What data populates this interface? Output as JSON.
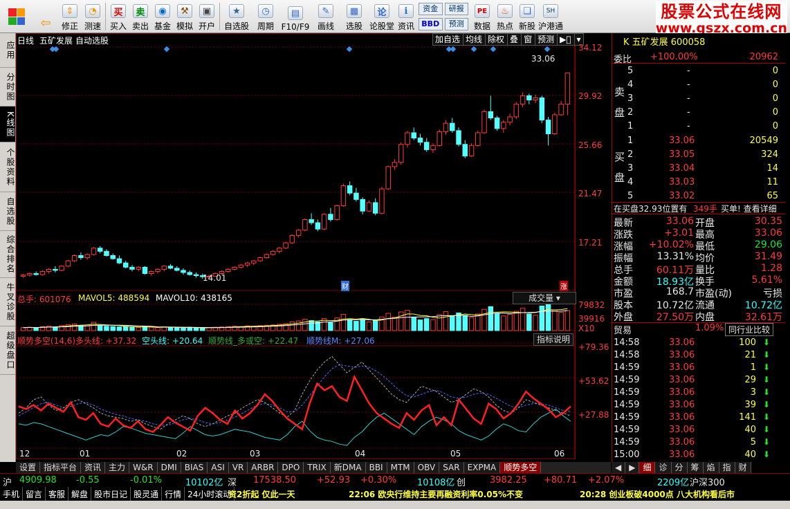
{
  "toolbar": [
    {
      "label": "修正",
      "icon": "up-down-arrows-icon"
    },
    {
      "label": "测速",
      "icon": "speedometer-icon"
    },
    {
      "label": "买入",
      "icon": "buy-icon",
      "glyph": "买"
    },
    {
      "label": "卖出",
      "icon": "sell-icon",
      "glyph": "卖"
    },
    {
      "label": "基金",
      "icon": "fund-icon"
    },
    {
      "label": "模拟",
      "icon": "hammer-icon"
    },
    {
      "label": "开户",
      "icon": "lock-icon"
    },
    {
      "label": "自选股",
      "icon": "star-folder-icon"
    },
    {
      "label": "周期",
      "icon": "clock-icon"
    },
    {
      "label": "F10/F9",
      "icon": "f10-icon"
    },
    {
      "label": "画线",
      "icon": "pen-icon"
    },
    {
      "label": "选股",
      "icon": "screen-icon"
    },
    {
      "label": "论股堂",
      "icon": "chat-icon"
    },
    {
      "label": "资讯",
      "icon": "info-icon"
    },
    {
      "label": "数据",
      "icon": "pe-icon"
    },
    {
      "label": "热点",
      "icon": "fire-icon"
    },
    {
      "label": "新股",
      "icon": "new-stock-icon"
    },
    {
      "label": "沪港通",
      "icon": "hk-icon"
    }
  ],
  "toolbar_mini": {
    "zijin": "资金",
    "yanbao": "研报",
    "bbd": "BBD",
    "yuce": "预测"
  },
  "logo": {
    "line1": "股票公式在线网",
    "line2": "www.gszx.com.cn"
  },
  "left_tabs": [
    "应用",
    "分时图",
    "K线图",
    "个股资料",
    "自选股",
    "综合排名",
    "牛叉诊股",
    "超级盘口"
  ],
  "chart_header": {
    "period": "日线",
    "name": "五矿发展",
    "mode": "自动选股",
    "buttons": [
      "加自选",
      "均线",
      "除权",
      "叠",
      "窗",
      "预测"
    ]
  },
  "price_axis": [
    "34.12",
    "29.92",
    "25.66",
    "21.47",
    "17.21"
  ],
  "price_labels": {
    "high": "33.06",
    "low": "14.01",
    "cai": "财",
    "zhang": "涨"
  },
  "volume_header": {
    "total": "总手: 601076",
    "mavol5": "MAVOL5: 488594",
    "mavol10": "MAVOL10: 438165",
    "selector": "成交量"
  },
  "volume_axis": [
    "79832",
    "39916",
    "X10"
  ],
  "indicator_header": {
    "name": "顺势多空(14,6)",
    "duotou": "多头线: +37.32",
    "kongtou": "空头线: +20.64",
    "shunshi": "顺势线_多或空: +22.47",
    "shunshiM": "顺势线M: +27.06",
    "help": "指标说明"
  },
  "indicator_axis": [
    "+79.36",
    "+53.62",
    "+27.88"
  ],
  "x_axis": [
    "12",
    "01",
    "02",
    "03",
    "04",
    "05",
    "06"
  ],
  "bottom_tabs": [
    "设置",
    "指标平台",
    "资讯",
    "主力",
    "W&R",
    "DMI",
    "BIAS",
    "ASI",
    "VR",
    "ARBR",
    "DPO",
    "TRIX",
    "新DMA",
    "BBI",
    "MTM",
    "OBV",
    "SAR",
    "EXPMA",
    "顺势多空"
  ],
  "bottom_tabs_right": [
    "细",
    "诊",
    "分",
    "筹",
    "焰",
    "指",
    "财"
  ],
  "quote": {
    "title": "K 五矿发展 600058",
    "weibi": "委比",
    "weibi_val": "+100.00%",
    "weibi_num": "20962",
    "sell_label": [
      "卖",
      "盘"
    ],
    "buy_label": [
      "买",
      "盘"
    ],
    "sell": [
      [
        "5",
        "-",
        "0"
      ],
      [
        "4",
        "-",
        "0"
      ],
      [
        "3",
        "-",
        "0"
      ],
      [
        "2",
        "-",
        "0"
      ],
      [
        "1",
        "-",
        "0"
      ]
    ],
    "buy": [
      [
        "1",
        "33.06",
        "20549"
      ],
      [
        "2",
        "33.05",
        "324"
      ],
      [
        "3",
        "33.04",
        "14"
      ],
      [
        "4",
        "33.03",
        "11"
      ],
      [
        "5",
        "33.02",
        "65"
      ]
    ],
    "buy_note": "在买盘32.93位置有",
    "buy_note_amt": "349手",
    "buy_note2": "买单! 查看详细",
    "stats": [
      [
        "最新",
        "33.06",
        "开盘",
        "30.35"
      ],
      [
        "涨跌",
        "+3.01",
        "最高",
        "33.06"
      ],
      [
        "涨幅",
        "+10.02%",
        "最低",
        "29.06"
      ],
      [
        "振幅",
        "13.31%",
        "均价",
        "31.49"
      ],
      [
        "总手",
        "60.11万",
        "量比",
        "1.28"
      ],
      [
        "金额",
        "18.93亿",
        "换手",
        "5.61%"
      ],
      [
        "市盈",
        "168.7",
        "市盈(动)",
        "亏损"
      ],
      [
        "股本",
        "10.72亿",
        "流通",
        "10.72亿"
      ],
      [
        "外盘",
        "27.50万",
        "内盘",
        "32.61万"
      ]
    ],
    "industry": "贸易",
    "industry_pct": "1.09%",
    "industry_btn": "同行业比较",
    "ticks": [
      [
        "14:58",
        "33.06",
        "100"
      ],
      [
        "14:58",
        "33.06",
        "21"
      ],
      [
        "14:59",
        "33.06",
        "1"
      ],
      [
        "14:59",
        "33.06",
        "29"
      ],
      [
        "14:59",
        "33.06",
        "3"
      ],
      [
        "14:59",
        "33.06",
        "39"
      ],
      [
        "14:59",
        "33.06",
        "141"
      ],
      [
        "14:59",
        "33.06",
        "40"
      ],
      [
        "14:59",
        "33.06",
        "5"
      ],
      [
        "15:00",
        "33.06",
        "40"
      ]
    ]
  },
  "status": {
    "sh": "沪",
    "sh_val": "4909.98",
    "sh_chg": "-0.55",
    "sh_pct": "-0.01%",
    "sh_amt": "10102亿",
    "sz": "深",
    "sz_val": "17538.50",
    "sz_chg": "+52.93",
    "sz_pct": "+0.30%",
    "sz_amt": "10108亿",
    "cy": "创",
    "cy_val": "3982.25",
    "cy_chg": "+80.71",
    "cy_pct": "+2.07%",
    "cy_amt": "2209亿",
    "hs": "沪深300"
  },
  "news": {
    "items": [
      "手机",
      "留言",
      "客服",
      "解盘",
      "股市日记",
      "股灵通",
      "行情",
      "24小时滚动"
    ],
    "n1": "资2折起 仅此一天",
    "n2": "22:06 欧央行维持主要再融资利率0.05%不变",
    "n3": "20:28 创业板破4000点 八大机构看后市"
  },
  "colors": {
    "up": "#ff3b3b",
    "down": "#54ffff",
    "grid": "#7a0000"
  },
  "chart_data": {
    "type": "candlestick",
    "ylim": [
      12.5,
      35.5
    ],
    "ohlc": [
      [
        13.85,
        14.05,
        13.7,
        13.95
      ],
      [
        13.95,
        14.2,
        13.8,
        14.1
      ],
      [
        14.1,
        14.3,
        13.9,
        14.0
      ],
      [
        14.0,
        14.4,
        13.9,
        14.3
      ],
      [
        14.3,
        14.6,
        14.1,
        14.5
      ],
      [
        14.5,
        14.8,
        14.2,
        14.4
      ],
      [
        14.4,
        14.9,
        14.3,
        14.8
      ],
      [
        14.8,
        15.4,
        14.7,
        15.3
      ],
      [
        15.3,
        15.9,
        15.2,
        15.8
      ],
      [
        15.8,
        16.1,
        15.4,
        15.6
      ],
      [
        15.6,
        16.0,
        15.4,
        15.9
      ],
      [
        15.9,
        16.6,
        15.8,
        16.5
      ],
      [
        16.5,
        16.7,
        16.0,
        16.2
      ],
      [
        16.2,
        16.4,
        15.7,
        15.8
      ],
      [
        15.8,
        16.0,
        15.4,
        15.5
      ],
      [
        15.5,
        15.8,
        15.0,
        15.1
      ],
      [
        15.1,
        15.3,
        14.6,
        14.7
      ],
      [
        14.7,
        14.9,
        14.3,
        14.5
      ],
      [
        14.5,
        14.8,
        14.3,
        14.7
      ],
      [
        14.7,
        14.8,
        14.0,
        14.1
      ],
      [
        14.1,
        14.4,
        13.9,
        14.3
      ],
      [
        14.3,
        14.6,
        14.1,
        14.5
      ],
      [
        14.5,
        14.9,
        14.3,
        14.8
      ],
      [
        14.8,
        15.0,
        14.5,
        14.6
      ],
      [
        14.6,
        14.8,
        14.3,
        14.4
      ],
      [
        14.4,
        14.6,
        14.0,
        14.2
      ],
      [
        14.2,
        14.4,
        13.9,
        14.0
      ],
      [
        14.0,
        14.2,
        13.7,
        13.9
      ],
      [
        13.9,
        14.1,
        13.6,
        13.8
      ],
      [
        13.8,
        14.0,
        13.6,
        13.85
      ],
      [
        13.85,
        14.2,
        13.8,
        14.1
      ],
      [
        14.1,
        14.4,
        14.0,
        14.3
      ],
      [
        14.3,
        14.6,
        14.2,
        14.5
      ],
      [
        14.5,
        14.8,
        14.4,
        14.7
      ],
      [
        14.7,
        15.0,
        14.6,
        14.9
      ],
      [
        14.9,
        15.2,
        14.7,
        15.1
      ],
      [
        15.1,
        15.4,
        14.9,
        15.3
      ],
      [
        15.3,
        15.7,
        15.2,
        15.6
      ],
      [
        15.6,
        16.0,
        15.5,
        15.9
      ],
      [
        15.9,
        16.3,
        15.8,
        16.2
      ],
      [
        16.2,
        16.6,
        16.0,
        16.5
      ],
      [
        16.5,
        17.1,
        16.4,
        17.0
      ],
      [
        17.0,
        17.8,
        16.9,
        17.7
      ],
      [
        17.7,
        18.3,
        17.5,
        18.2
      ],
      [
        18.2,
        19.3,
        18.1,
        19.2
      ],
      [
        19.2,
        19.8,
        18.7,
        18.9
      ],
      [
        18.9,
        19.2,
        18.1,
        18.3
      ],
      [
        18.3,
        19.8,
        18.2,
        19.7
      ],
      [
        19.7,
        20.3,
        19.0,
        19.2
      ],
      [
        19.2,
        20.6,
        19.1,
        20.5
      ],
      [
        20.5,
        22.6,
        20.4,
        22.4
      ],
      [
        22.4,
        22.8,
        21.5,
        21.7
      ],
      [
        21.7,
        22.2,
        20.9,
        21.1
      ],
      [
        21.1,
        21.3,
        19.7,
        20.0
      ],
      [
        20.0,
        21.0,
        19.9,
        20.8
      ],
      [
        20.8,
        21.2,
        19.6,
        19.8
      ],
      [
        19.8,
        22.3,
        19.7,
        22.1
      ],
      [
        22.1,
        24.3,
        22.0,
        24.2
      ],
      [
        24.2,
        24.9,
        23.9,
        24.6
      ],
      [
        24.6,
        26.5,
        24.4,
        26.3
      ],
      [
        26.3,
        27.6,
        26.0,
        27.4
      ],
      [
        27.4,
        27.9,
        26.7,
        26.9
      ],
      [
        26.9,
        27.3,
        26.2,
        26.5
      ],
      [
        26.5,
        26.9,
        25.6,
        25.8
      ],
      [
        25.8,
        26.4,
        25.5,
        26.2
      ],
      [
        26.2,
        27.7,
        26.1,
        27.5
      ],
      [
        27.5,
        28.6,
        27.2,
        28.3
      ],
      [
        28.3,
        28.8,
        27.4,
        27.6
      ],
      [
        27.6,
        27.9,
        26.1,
        26.3
      ],
      [
        26.3,
        26.7,
        25.0,
        25.2
      ],
      [
        25.2,
        26.4,
        25.1,
        26.2
      ],
      [
        26.2,
        27.6,
        26.1,
        27.4
      ],
      [
        27.4,
        29.6,
        27.3,
        29.4
      ],
      [
        29.4,
        30.9,
        28.6,
        28.8
      ],
      [
        28.8,
        29.0,
        27.6,
        27.8
      ],
      [
        27.8,
        28.6,
        27.4,
        28.4
      ],
      [
        28.4,
        29.2,
        28.1,
        28.9
      ],
      [
        28.9,
        30.3,
        28.7,
        30.1
      ],
      [
        30.1,
        31.2,
        29.8,
        30.9
      ],
      [
        30.9,
        31.1,
        30.1,
        30.5
      ],
      [
        30.5,
        31.0,
        30.2,
        30.7
      ],
      [
        30.7,
        30.9,
        28.3,
        28.6
      ],
      [
        28.6,
        28.9,
        26.2,
        27.3
      ],
      [
        27.3,
        29.3,
        27.2,
        29.1
      ],
      [
        29.1,
        30.4,
        29.0,
        30.1
      ],
      [
        30.1,
        33.06,
        29.06,
        33.06
      ]
    ],
    "volume": [
      0.9,
      1.0,
      0.8,
      1.2,
      1.3,
      1.1,
      1.5,
      1.8,
      2.0,
      1.6,
      1.7,
      2.5,
      1.4,
      1.3,
      1.2,
      1.1,
      1.3,
      1.0,
      0.9,
      1.2,
      1.0,
      0.9,
      1.1,
      1.0,
      0.8,
      0.9,
      1.0,
      0.8,
      0.7,
      0.9,
      1.0,
      1.1,
      1.2,
      1.3,
      1.2,
      1.4,
      1.3,
      1.5,
      1.6,
      1.7,
      1.9,
      2.1,
      2.6,
      2.9,
      3.4,
      3.0,
      2.6,
      3.6,
      2.4,
      3.8,
      4.9,
      3.3,
      2.8,
      3.4,
      2.6,
      3.0,
      4.1,
      5.2,
      4.0,
      5.6,
      6.1,
      3.9,
      3.2,
      3.6,
      3.3,
      4.8,
      5.7,
      4.5,
      5.3,
      4.6,
      3.9,
      5.0,
      6.4,
      7.2,
      5.1,
      4.4,
      4.9,
      5.8,
      6.7,
      5.0,
      4.6,
      7.4,
      7.9,
      6.2,
      5.5,
      6.0
    ]
  },
  "indicator_data": {
    "ylim": [
      12,
      88
    ],
    "duotou": [
      43,
      41,
      44,
      40,
      45,
      42,
      39,
      46,
      35,
      33,
      38,
      30,
      28,
      34,
      29,
      27,
      32,
      26,
      24,
      29,
      35,
      31,
      28,
      25,
      36,
      42,
      38,
      33,
      30,
      40,
      34,
      38,
      44,
      52,
      47,
      40,
      34,
      30,
      26,
      45,
      60,
      55,
      58,
      50,
      47,
      65,
      55,
      45,
      38,
      34,
      30,
      27,
      38,
      33,
      40,
      44,
      29,
      35,
      29,
      48,
      41,
      34,
      30,
      45,
      41,
      34,
      38,
      45,
      54,
      49,
      45,
      41,
      35,
      38,
      43
    ],
    "kongtou": [
      30,
      29,
      31,
      30,
      28,
      26,
      24,
      22,
      20,
      18,
      20,
      22,
      21,
      24,
      28,
      27,
      25,
      23,
      22,
      21,
      20,
      19,
      23,
      28,
      25,
      22,
      21,
      22,
      24,
      26,
      25,
      24,
      22,
      20,
      19,
      18,
      22,
      28,
      32,
      25,
      20,
      18,
      17,
      15,
      14,
      20,
      24,
      30,
      35,
      38,
      34,
      30,
      26,
      22,
      28,
      32,
      35,
      33,
      30,
      25,
      22,
      20,
      18,
      21,
      26,
      30,
      28,
      25,
      24,
      30,
      35,
      38,
      41,
      36,
      32
    ],
    "shunshi": [
      38,
      42,
      48,
      50,
      44,
      40,
      42,
      46,
      48,
      45,
      42,
      38,
      36,
      35,
      34,
      32,
      33,
      30,
      28,
      26,
      30,
      33,
      36,
      34,
      30,
      28,
      30,
      33,
      36,
      38,
      42,
      45,
      48,
      46,
      42,
      38,
      35,
      40,
      52,
      62,
      70,
      76,
      80,
      74,
      68,
      72,
      76,
      70,
      64,
      58,
      52,
      48,
      46,
      52,
      58,
      56,
      54,
      50,
      46,
      48,
      52,
      56,
      54,
      50,
      44,
      40,
      38,
      42,
      48,
      46,
      44,
      42,
      40,
      38,
      36
    ],
    "shunshiM": [
      36,
      39,
      42,
      45,
      46,
      44,
      42,
      43,
      45,
      46,
      44,
      41,
      39,
      37,
      36,
      34,
      33,
      32,
      30,
      29,
      29,
      31,
      33,
      34,
      33,
      31,
      30,
      31,
      33,
      35,
      38,
      41,
      44,
      45,
      44,
      42,
      39,
      39,
      44,
      51,
      58,
      65,
      71,
      74,
      73,
      72,
      73,
      72,
      69,
      65,
      60,
      55,
      51,
      50,
      52,
      54,
      55,
      53,
      50,
      49,
      50,
      52,
      53,
      52,
      49,
      46,
      43,
      42,
      44,
      45,
      45,
      44,
      42,
      40,
      39
    ]
  }
}
